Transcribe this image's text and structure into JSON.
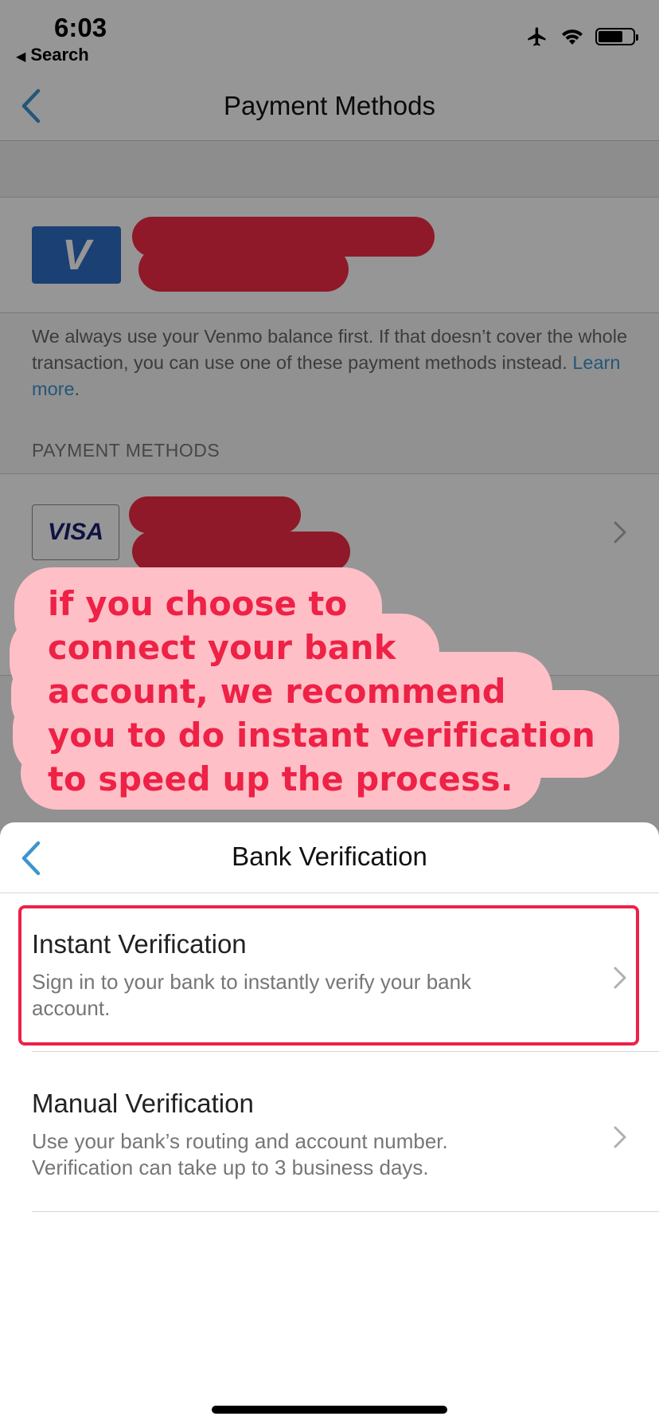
{
  "status_bar": {
    "time": "6:03",
    "back_app": "Search",
    "icons": [
      "airplane-icon",
      "wifi-icon",
      "battery-icon"
    ]
  },
  "nav": {
    "title": "Payment Methods",
    "back_icon": "chevron-left-icon"
  },
  "venmo": {
    "logo_text": "V"
  },
  "info": {
    "text": "We always use your Venmo balance first. If that doesn’t cover the whole transaction, you can use one of these payment methods instead. ",
    "link": "Learn more",
    "trailing": "."
  },
  "payment_methods": {
    "section_label": "PAYMENT METHODS",
    "card_brand": "VISA"
  },
  "annotation": {
    "text": "if you choose to\nconnect your bank\naccount, we recommend\nyou to do instant verification\nto speed up the process."
  },
  "sheet": {
    "title": "Bank Verification",
    "options": [
      {
        "title": "Instant Verification",
        "description": "Sign in to your bank to instantly verify your bank account."
      },
      {
        "title": "Manual Verification",
        "description": "Use your bank’s routing and account number. Verification can take up to 3 business days."
      }
    ]
  },
  "colors": {
    "accent": "#3d95ce",
    "venmo_blue": "#2d6ec6",
    "redaction": "#f42c45",
    "annotation_fill": "#ffbfc7",
    "annotation_text": "#ee2146",
    "highlight_border": "#ee2146"
  }
}
